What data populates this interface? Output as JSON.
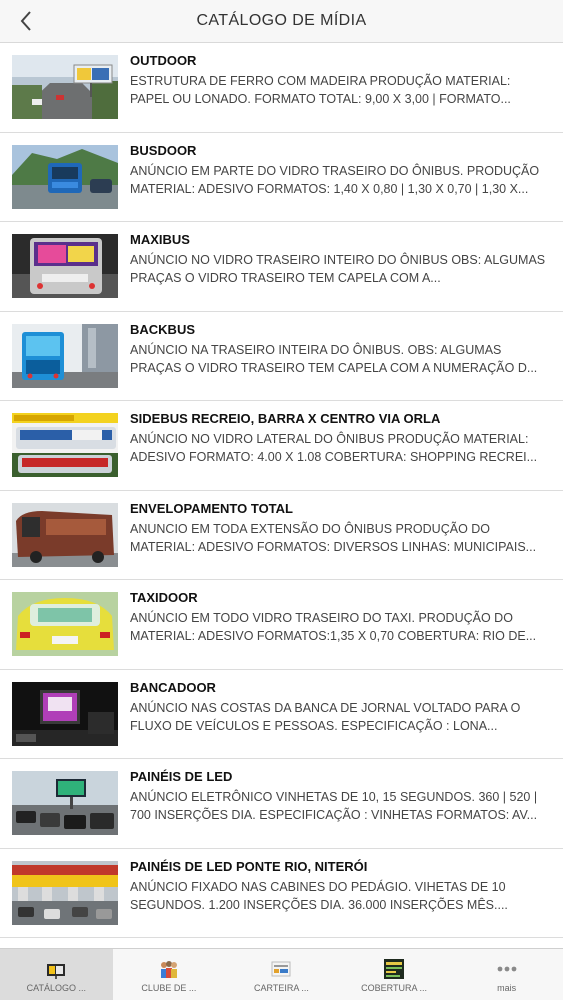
{
  "header": {
    "title": "CATÁLOGO DE MÍDIA"
  },
  "items": [
    {
      "title": "OUTDOOR",
      "desc": "ESTRUTURA DE FERRO COM MADEIRA PRODUÇÃO MATERIAL: PAPEL OU LONADO. FORMATO TOTAL: 9,00 X 3,00 | FORMATO..."
    },
    {
      "title": "BUSDOOR",
      "desc": "ANÚNCIO EM PARTE DO VIDRO TRASEIRO DO ÔNIBUS. PRODUÇÃO MATERIAL: ADESIVO FORMATOS: 1,40 X 0,80 | 1,30 X 0,70 | 1,30 X..."
    },
    {
      "title": "MAXIBUS",
      "desc": "ANÚNCIO NO VIDRO TRASEIRO INTEIRO DO ÔNIBUS OBS: ALGUMAS PRAÇAS O VIDRO TRASEIRO TEM CAPELA COM A..."
    },
    {
      "title": "BACKBUS",
      "desc": "ANÚNCIO NA TRASEIRO INTEIRA DO ÔNIBUS. OBS: ALGUMAS PRAÇAS O VIDRO TRASEIRO TEM CAPELA COM A NUMERAÇÃO D..."
    },
    {
      "title": "SIDEBUS RECREIO, BARRA X CENTRO VIA ORLA",
      "desc": "ANÚNCIO NO VIDRO LATERAL DO ÔNIBUS PRODUÇÃO MATERIAL: ADESIVO FORMATO: 4.00 X 1.08 COBERTURA: SHOPPING RECREI..."
    },
    {
      "title": "ENVELOPAMENTO TOTAL",
      "desc": "ANUNCIO EM TODA EXTENSÃO DO ÔNIBUS PRODUÇÃO DO MATERIAL: ADESIVO FORMATOS: DIVERSOS LINHAS: MUNICIPAIS..."
    },
    {
      "title": "TAXIDOOR",
      "desc": "ANÚNCIO EM TODO VIDRO TRASEIRO DO TAXI. PRODUÇÃO DO MATERIAL: ADESIVO FORMATOS:1,35 X 0,70 COBERTURA: RIO DE..."
    },
    {
      "title": "BANCADOOR",
      "desc": "ANÚNCIO NAS COSTAS DA BANCA DE JORNAL VOLTADO PARA O FLUXO DE VEÍCULOS E PESSOAS. ESPECIFICAÇÃO : LONA..."
    },
    {
      "title": "PAINÉIS DE LED",
      "desc": "ANÚNCIO ELETRÔNICO VINHETAS DE 10, 15 SEGUNDOS. 360 | 520 | 700 INSERÇÕES DIA. ESPECIFICAÇÃO : VINHETAS FORMATOS: AV..."
    },
    {
      "title": "PAINÉIS DE LED PONTE RIO, NITERÓI",
      "desc": "ANÚNCIO FIXADO NAS CABINES DO PEDÁGIO. VIHETAS DE 10 SEGUNDOS. 1.200 INSERÇÕES DIA. 36.000 INSERÇÕES MÊS...."
    }
  ],
  "tabs": [
    {
      "label": "CATÁLOGO ...",
      "icon": "catalog-icon"
    },
    {
      "label": "CLUBE DE ...",
      "icon": "club-icon"
    },
    {
      "label": "CARTEIRA ...",
      "icon": "wallet-icon"
    },
    {
      "label": "COBERTURA ...",
      "icon": "coverage-icon"
    },
    {
      "label": "mais",
      "icon": "more-icon"
    }
  ]
}
